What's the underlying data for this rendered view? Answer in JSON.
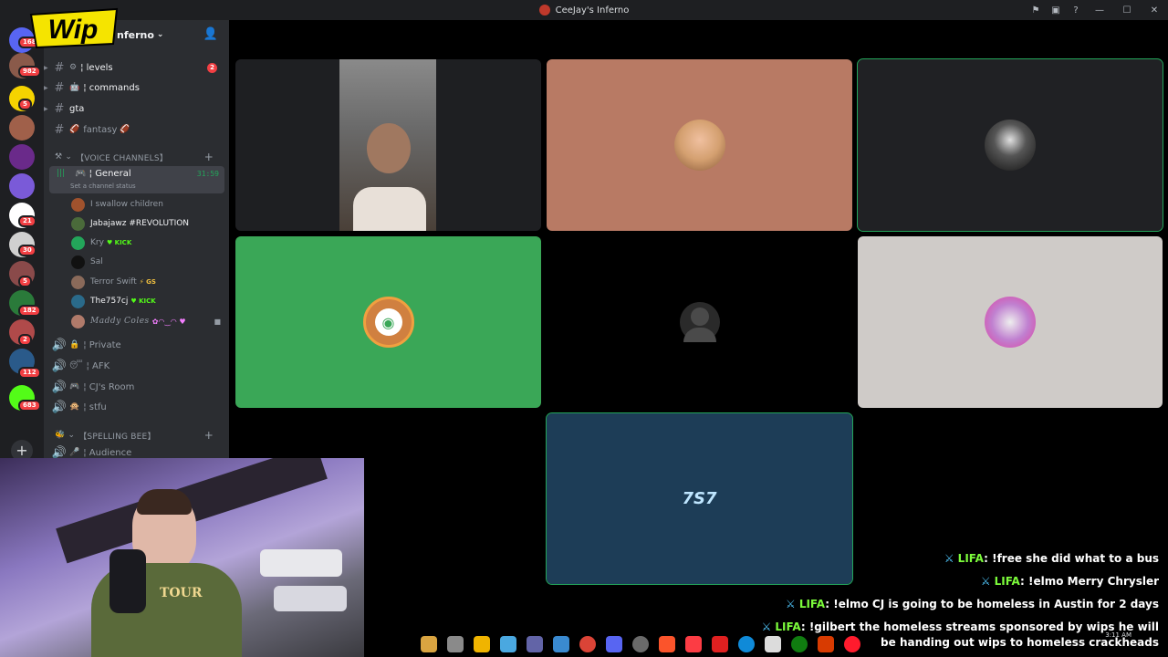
{
  "window": {
    "title": "CeeJay's Inferno",
    "buttons": [
      "inbox",
      "screen-share",
      "help",
      "minimize",
      "maximize",
      "close"
    ]
  },
  "overlay": {
    "logo_text": "Wip"
  },
  "guilds": {
    "badges": [
      "168",
      "982",
      "5",
      "21",
      "30",
      "5",
      "182",
      "2",
      "112",
      "683"
    ],
    "add_server_label": "+"
  },
  "server": {
    "name": "CeeJay's Inferno",
    "header_tail": "nferno"
  },
  "text_channels": [
    {
      "label": "levels",
      "emoji": "⚙",
      "badge": "2"
    },
    {
      "label": "commands",
      "emoji": "🤖"
    },
    {
      "label": "gta",
      "emoji": ""
    },
    {
      "label": "fantasy",
      "emoji": "🏈",
      "suffix": "🏈"
    }
  ],
  "categories": {
    "voice": "【VOICE CHANNELS】",
    "spelling": "【SPELLING BEE】"
  },
  "voice_channel": {
    "label": "General",
    "timer": "31:59",
    "status": "Set a channel status"
  },
  "voice_users": [
    {
      "name": "I swallow children",
      "color": "#a0522d"
    },
    {
      "name": "Jabajawz #REVOLUTION",
      "color": "#4a6a3a",
      "highlight": true
    },
    {
      "name": "Kry",
      "color": "#23a55a",
      "tag": "KICK"
    },
    {
      "name": "Sal",
      "color": "#111111"
    },
    {
      "name": "Terror Swift",
      "color": "#8a6a5a",
      "tag": "GS"
    },
    {
      "name": "The757cj",
      "color": "#2a6a8a",
      "tag": "KICK",
      "highlight": true
    },
    {
      "name": "Maddy Coles",
      "color": "#b07a6a",
      "extra": "✿◠‿◠ ♥"
    }
  ],
  "voice_channels": [
    {
      "label": "Private",
      "emoji": "🔒"
    },
    {
      "label": "AFK",
      "emoji": "😴"
    },
    {
      "label": "CJ's Room",
      "emoji": "🎮"
    },
    {
      "label": "stfu",
      "emoji": "🙊"
    },
    {
      "label": "Audience",
      "emoji": "🎤"
    }
  ],
  "tiles": [
    {
      "name": "video-tile-camera",
      "bg": "#1e1f22"
    },
    {
      "name": "avatar-tile-blonde",
      "bg": "#b87a64"
    },
    {
      "name": "avatar-tile-suit",
      "bg": "#202124",
      "speaking": true
    },
    {
      "name": "avatar-tile-discord",
      "bg": "#3aa757"
    },
    {
      "name": "avatar-tile-default",
      "bg": "#000000"
    },
    {
      "name": "avatar-tile-robot",
      "bg": "#cfcbc8"
    },
    {
      "name": "avatar-tile-757",
      "bg": "#1d3d57",
      "speaking": true
    }
  ],
  "chat": [
    {
      "user": "LIFA",
      "text": "!free she did what to a bus"
    },
    {
      "user": "LIFA",
      "text": "!elmo Merry Chrysler"
    },
    {
      "user": "LIFA",
      "text": "!elmo CJ is going to be homeless in Austin for 2 days"
    },
    {
      "user": "LIFA",
      "text": "!gilbert the homeless streams sponsored by wips he will be handing out wips to homeless crackheads"
    }
  ],
  "taskbar": {
    "icons": [
      "widgets",
      "taskview",
      "explorer",
      "copilot",
      "teams",
      "store",
      "chrome",
      "discord",
      "settings",
      "brave",
      "music",
      "app",
      "edge",
      "taskbar-app",
      "xbox",
      "office",
      "opera"
    ],
    "clock": "3:11 AM"
  },
  "colors": {
    "accent_green": "#23a55a",
    "badge_red": "#f23f43",
    "chat_user": "#7cfc3b"
  }
}
